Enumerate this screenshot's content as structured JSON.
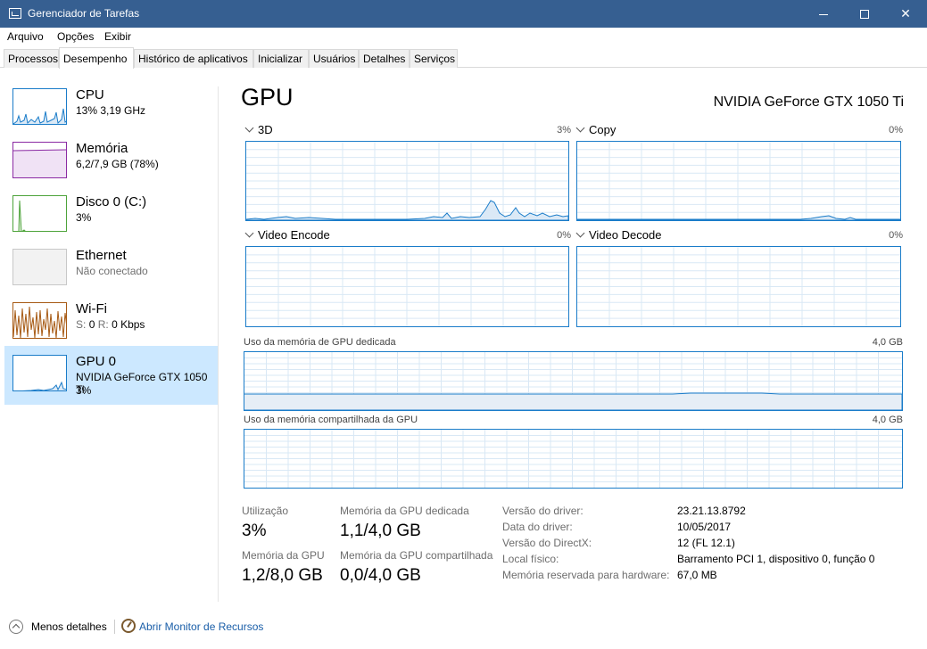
{
  "window": {
    "title": "Gerenciador de Tarefas"
  },
  "menu": [
    "Arquivo",
    "Opções",
    "Exibir"
  ],
  "tabs": [
    "Processos",
    "Desempenho",
    "Histórico de aplicativos",
    "Inicializar",
    "Usuários",
    "Detalhes",
    "Serviços"
  ],
  "active_tab": "Desempenho",
  "sidebar": [
    {
      "name": "CPU",
      "sub": "13% 3,19 GHz",
      "color": "#1a7cc9"
    },
    {
      "name": "Memória",
      "sub": "6,2/7,9 GB (78%)",
      "color": "#8b2aa3"
    },
    {
      "name": "Disco 0 (C:)",
      "sub": "3%",
      "color": "#4da33a"
    },
    {
      "name": "Ethernet",
      "sub": "Não conectado",
      "color": "#a0a0a0"
    },
    {
      "name": "Wi-Fi",
      "sub_s": "S:",
      "sub_s_val": "0",
      "sub_r": "R:",
      "sub_r_val": "0 Kbps",
      "color": "#a75a14"
    },
    {
      "name": "GPU 0",
      "sub": "NVIDIA GeForce GTX 1050 Ti",
      "sub2": "3%",
      "color": "#1a7cc9"
    }
  ],
  "main": {
    "title": "GPU",
    "model": "NVIDIA GeForce GTX 1050 Ti",
    "engines": [
      {
        "name": "3D",
        "pct": "3%"
      },
      {
        "name": "Copy",
        "pct": "0%"
      },
      {
        "name": "Video Encode",
        "pct": "0%"
      },
      {
        "name": "Video Decode",
        "pct": "0%"
      }
    ],
    "dedicated_label": "Uso da memória de GPU dedicada",
    "dedicated_max": "4,0 GB",
    "shared_label": "Uso da memória compartilhada da GPU",
    "shared_max": "4,0 GB"
  },
  "stats": {
    "utilization_label": "Utilização",
    "utilization": "3%",
    "dedicated_label": "Memória da GPU dedicada",
    "dedicated": "1,1/4,0 GB",
    "gpu_mem_label": "Memória da GPU",
    "gpu_mem": "1,2/8,0 GB",
    "shared_label": "Memória da GPU compartilhada",
    "shared": "0,0/4,0 GB"
  },
  "info": [
    {
      "label": "Versão do driver:",
      "value": "23.21.13.8792"
    },
    {
      "label": "Data do driver:",
      "value": "10/05/2017"
    },
    {
      "label": "Versão do DirectX:",
      "value": "12 (FL 12.1)"
    },
    {
      "label": "Local físico:",
      "value": "Barramento PCI 1, dispositivo 0, função 0"
    },
    {
      "label": "Memória reservada para hardware:",
      "value": "67,0 MB"
    }
  ],
  "footer": {
    "less": "Menos detalhes",
    "monitor": "Abrir Monitor de Recursos"
  }
}
